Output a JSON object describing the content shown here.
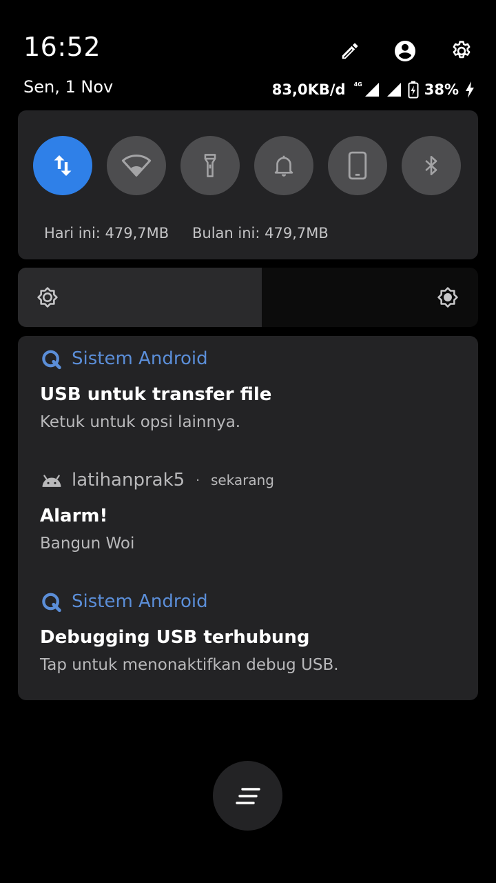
{
  "header": {
    "time": "16:52",
    "date": "Sen, 1 Nov",
    "icons": [
      "edit-icon",
      "account-icon",
      "settings-icon"
    ]
  },
  "status": {
    "net_speed": "83,0KB/d",
    "network_type": "4G",
    "battery": "38%"
  },
  "quick_settings": {
    "tiles": [
      {
        "icon": "mobile-data-icon",
        "active": true
      },
      {
        "icon": "wifi-icon",
        "active": false
      },
      {
        "icon": "flashlight-icon",
        "active": false
      },
      {
        "icon": "bell-icon",
        "active": false
      },
      {
        "icon": "screen-rotate-icon",
        "active": false
      },
      {
        "icon": "bluetooth-icon",
        "active": false
      }
    ],
    "usage_today": "Hari ini: 479,7MB",
    "usage_month": "Bulan ini: 479,7MB",
    "accent": "#2f80e8"
  },
  "brightness": {
    "level": 0.53
  },
  "notifications": [
    {
      "app": "Sistem Android",
      "time": "",
      "title": "USB untuk transfer file",
      "text": "Ketuk untuk opsi lainnya."
    },
    {
      "app": "latihanprak5",
      "time": "sekarang",
      "separator": "·",
      "title": "Alarm!",
      "text": "Bangun Woi"
    },
    {
      "app": "Sistem Android",
      "time": "",
      "title": "Debugging USB terhubung",
      "text": "Tap untuk menonaktifkan debug USB."
    }
  ]
}
